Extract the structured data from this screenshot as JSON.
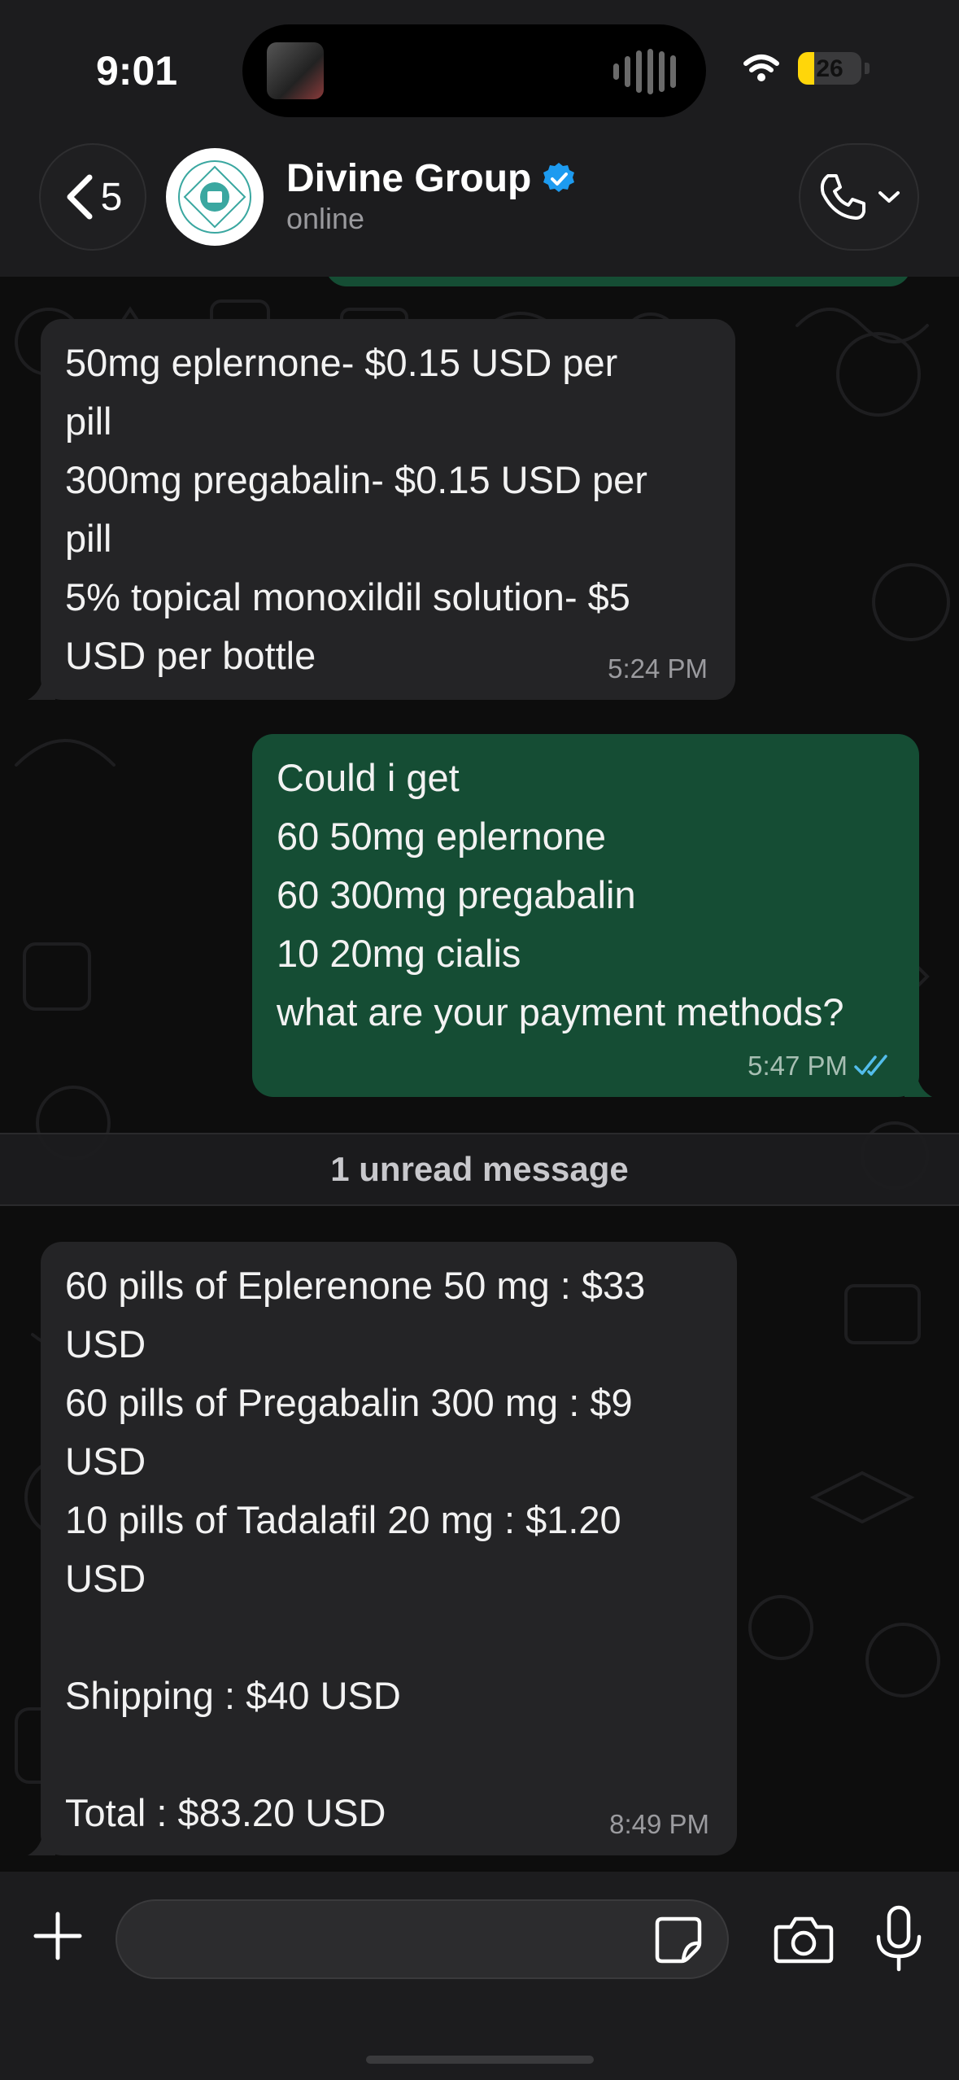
{
  "status_bar": {
    "time": "9:01",
    "battery": "26",
    "battery_fraction": 0.26
  },
  "header": {
    "back_count": "5",
    "contact_name": "Divine Group",
    "contact_status": "online",
    "verified": true
  },
  "colors": {
    "incoming_bubble": "#242426",
    "outgoing_bubble": "#154d34",
    "background": "#0d0d0d",
    "verified_badge": "#1d9bf0",
    "read_ticks": "#53bdeb"
  },
  "messages": [
    {
      "direction": "incoming",
      "lines": [
        "50mg eplernone- $0.15 USD per",
        "pill",
        "300mg pregabalin- $0.15 USD per",
        "pill",
        "5% topical monoxildil solution- $5",
        "USD per bottle"
      ],
      "time": "5:24 PM"
    },
    {
      "direction": "outgoing",
      "lines": [
        "Could i get",
        "60 50mg eplernone",
        "60 300mg pregabalin",
        "10 20mg cialis",
        "what are your payment methods?"
      ],
      "time": "5:47 PM",
      "status": "read"
    },
    {
      "direction": "incoming",
      "lines": [
        "60 pills of Eplerenone 50 mg : $33",
        "USD",
        "60 pills of Pregabalin 300 mg : $9",
        "USD",
        "10 pills of Tadalafil 20 mg : $1.20",
        "USD",
        "",
        "Shipping : $40 USD",
        "",
        "Total : $83.20 USD"
      ],
      "time": "8:49 PM"
    }
  ],
  "unread_divider": "1 unread message",
  "composer": {
    "value": "",
    "placeholder": ""
  }
}
